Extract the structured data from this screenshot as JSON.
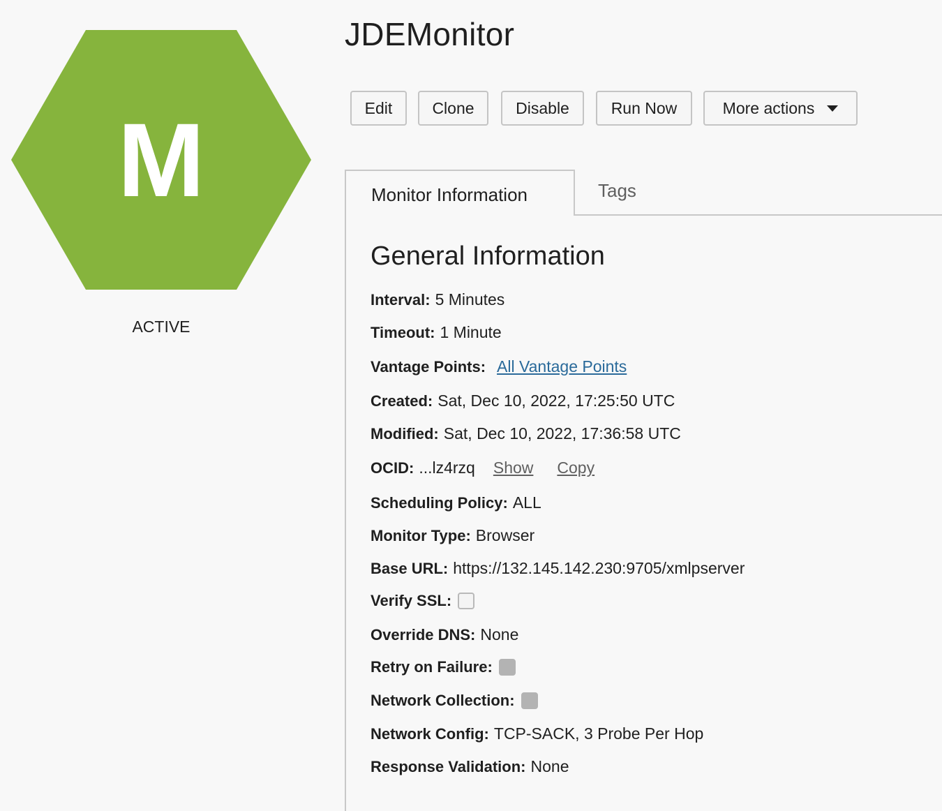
{
  "badge": {
    "letter": "M",
    "color": "#86b43d",
    "status": "ACTIVE"
  },
  "title": "JDEMonitor",
  "toolbar": {
    "edit": "Edit",
    "clone": "Clone",
    "disable": "Disable",
    "run_now": "Run Now",
    "more_actions": "More actions"
  },
  "tabs": {
    "monitor_information": "Monitor Information",
    "tags": "Tags"
  },
  "general": {
    "heading": "General Information",
    "interval_label": "Interval:",
    "interval_value": "5 Minutes",
    "timeout_label": "Timeout:",
    "timeout_value": "1 Minute",
    "vantage_label": "Vantage Points:",
    "vantage_link": "All Vantage Points",
    "created_label": "Created:",
    "created_value": "Sat, Dec 10, 2022, 17:25:50 UTC",
    "modified_label": "Modified:",
    "modified_value": "Sat, Dec 10, 2022, 17:36:58 UTC",
    "ocid_label": "OCID:",
    "ocid_value": "...lz4rzq",
    "ocid_show": "Show",
    "ocid_copy": "Copy",
    "scheduling_label": "Scheduling Policy:",
    "scheduling_value": "ALL",
    "type_label": "Monitor Type:",
    "type_value": "Browser",
    "base_url_label": "Base URL:",
    "base_url_value": "https://132.145.142.230:9705/xmlpserver",
    "verify_ssl_label": "Verify SSL:",
    "verify_ssl_checked": false,
    "override_dns_label": "Override DNS:",
    "override_dns_value": "None",
    "retry_label": "Retry on Failure:",
    "retry_checked": false,
    "network_collection_label": "Network Collection:",
    "network_collection_checked": false,
    "network_config_label": "Network Config:",
    "network_config_value": "TCP-SACK, 3 Probe Per Hop",
    "response_validation_label": "Response Validation:",
    "response_validation_value": "None"
  }
}
